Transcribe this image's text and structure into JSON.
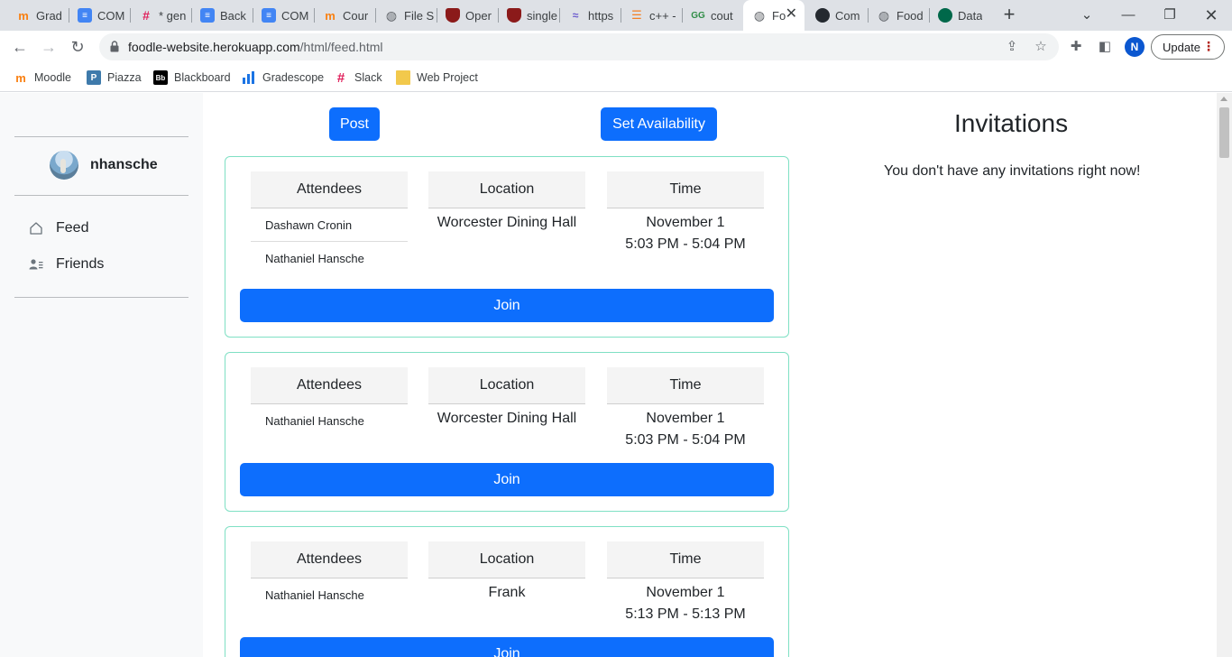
{
  "browser": {
    "tabs": [
      {
        "title": "Grad",
        "icon": "moodle-icon",
        "color": "#f98012"
      },
      {
        "title": "COM",
        "icon": "docs-icon",
        "color": "#4285f4"
      },
      {
        "title": "* gen",
        "icon": "slack-icon",
        "color": "#e01e5a"
      },
      {
        "title": "Back",
        "icon": "docs-icon",
        "color": "#4285f4"
      },
      {
        "title": "COM",
        "icon": "docs-icon",
        "color": "#4285f4"
      },
      {
        "title": "Cour",
        "icon": "moodle-icon",
        "color": "#f98012"
      },
      {
        "title": "File S",
        "icon": "globe-icon",
        "color": "#5f6368"
      },
      {
        "title": "Oper",
        "icon": "shield-icon",
        "color": "#8b1a1a"
      },
      {
        "title": "single",
        "icon": "shield-icon",
        "color": "#8b1a1a"
      },
      {
        "title": "https",
        "icon": "wave-icon",
        "color": "#6a5acd"
      },
      {
        "title": "c++ -",
        "icon": "stack-icon",
        "color": "#f48024"
      },
      {
        "title": "cout",
        "icon": "geeks-icon",
        "color": "#2f8d46"
      },
      {
        "title": "Fo",
        "icon": "globe-icon",
        "color": "#5f6368"
      },
      {
        "title": "Com",
        "icon": "github-icon",
        "color": "#24292f"
      },
      {
        "title": "Food",
        "icon": "globe-icon",
        "color": "#5f6368"
      },
      {
        "title": "Data",
        "icon": "mongodb-icon",
        "color": "#00684a"
      }
    ],
    "url_domain": "foodle-website.herokuapp.com",
    "url_path": "/html/feed.html",
    "profile_initial": "N",
    "update_label": "Update",
    "bookmarks": [
      {
        "label": "Moodle",
        "color": "#f98012"
      },
      {
        "label": "Piazza",
        "color": "#3e7aab"
      },
      {
        "label": "Blackboard",
        "color": "#000000"
      },
      {
        "label": "Gradescope",
        "color": "#1b74e4"
      },
      {
        "label": "Slack",
        "color": "#e01e5a"
      },
      {
        "label": "Web Project",
        "color": "#f2c94c"
      }
    ]
  },
  "sidebar": {
    "username": "nhansche",
    "nav": [
      {
        "label": "Feed",
        "icon": "house-icon"
      },
      {
        "label": "Friends",
        "icon": "people-icon"
      }
    ]
  },
  "actions": {
    "post_label": "Post",
    "availability_label": "Set Availability"
  },
  "labels": {
    "attendees": "Attendees",
    "location": "Location",
    "time": "Time",
    "join": "Join"
  },
  "meals": [
    {
      "attendees": [
        "Dashawn Cronin",
        "Nathaniel Hansche"
      ],
      "location": "Worcester Dining Hall",
      "date": "November 1",
      "time": "5:03 PM - 5:04 PM"
    },
    {
      "attendees": [
        "Nathaniel Hansche"
      ],
      "location": "Worcester Dining Hall",
      "date": "November 1",
      "time": "5:03 PM - 5:04 PM"
    },
    {
      "attendees": [
        "Nathaniel Hansche"
      ],
      "location": "Frank",
      "date": "November 1",
      "time": "5:13 PM - 5:13 PM"
    }
  ],
  "invitations": {
    "title": "Invitations",
    "empty_message": "You don't have any invitations right now!"
  },
  "colors": {
    "primary": "#0d6efd",
    "card_border": "#7fe0c4",
    "sidebar_bg": "#f8f9fa"
  }
}
